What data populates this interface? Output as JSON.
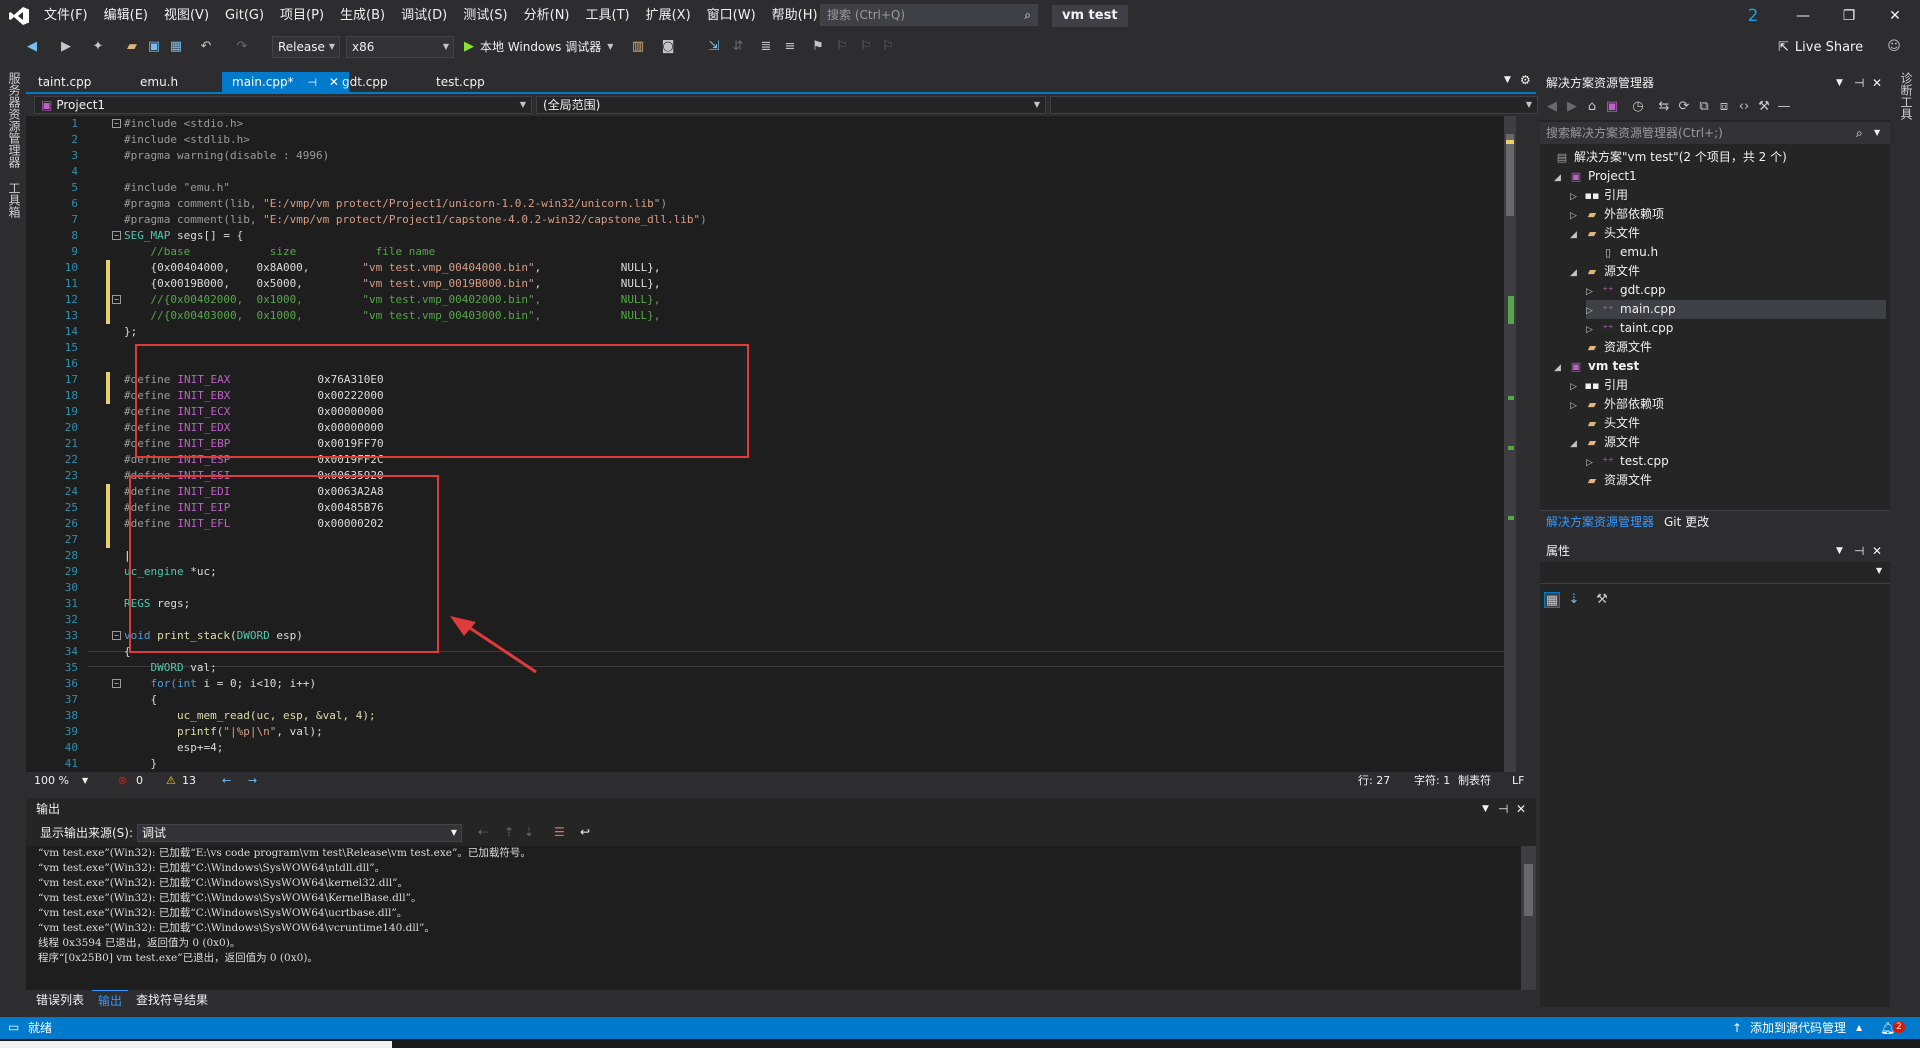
{
  "window": {
    "solution_name": "vm test",
    "notification_count": "2",
    "search_placeholder": "搜索 (Ctrl+Q)"
  },
  "menu": [
    "文件(F)",
    "编辑(E)",
    "视图(V)",
    "Git(G)",
    "项目(P)",
    "生成(B)",
    "调试(D)",
    "测试(S)",
    "分析(N)",
    "工具(T)",
    "扩展(X)",
    "窗口(W)",
    "帮助(H)"
  ],
  "toolbar": {
    "config": "Release",
    "platform": "x86",
    "run_label": "本地 Windows 调试器",
    "live_share": "Live Share"
  },
  "left_strip": [
    "服务器资源管理器",
    "工具箱"
  ],
  "right_strip": [
    "诊断工具"
  ],
  "tabs": [
    {
      "label": "taint.cpp"
    },
    {
      "label": "emu.h"
    },
    {
      "label": "main.cpp*"
    },
    {
      "label": "gdt.cpp"
    },
    {
      "label": "test.cpp"
    }
  ],
  "nav": {
    "project": "Project1",
    "scope": "(全局范围)"
  },
  "code": {
    "line_numbers": [
      "1",
      "2",
      "3",
      "4",
      "5",
      "6",
      "7",
      "8",
      "9",
      "10",
      "11",
      "12",
      "13",
      "14",
      "15",
      "16",
      "17",
      "18",
      "19",
      "20",
      "21",
      "22",
      "23",
      "24",
      "25",
      "26",
      "27",
      "28",
      "29",
      "30",
      "31",
      "32",
      "33",
      "34",
      "35",
      "36",
      "37",
      "38",
      "39",
      "40",
      "41"
    ],
    "l1": "#include <stdio.h>",
    "l2": "#include <stdlib.h>",
    "l3": "#pragma warning(disable : 4996)",
    "l5": "#include \"emu.h\"",
    "l6a": "#pragma comment(lib, ",
    "l6b": "\"E:/vmp/vm protect/Project1/unicorn-1.0.2-win32/unicorn.lib\"",
    "l6c": ")",
    "l7a": "#pragma comment(lib, ",
    "l7b": "\"E:/vmp/vm protect/Project1/capstone-4.0.2-win32/capstone_dll.lib\"",
    "l7c": ")",
    "l8a": "SEG_MAP",
    "l8b": " segs[] = {",
    "l9": "    //base            size            file name",
    "l10a": "    {0x00404000,    0x8A000,        ",
    "l10b": "\"vm test.vmp_00404000.bin\"",
    "l10c": ",            NULL},",
    "l11a": "    {0x0019B000,    0x5000,         ",
    "l11b": "\"vm test.vmp_0019B000.bin\"",
    "l11c": ",            NULL},",
    "l12": "    //{0x00402000,  0x1000,         \"vm test.vmp_00402000.bin\",            NULL},",
    "l13": "    //{0x00403000,  0x1000,         \"vm test.vmp_00403000.bin\",            NULL},",
    "l14": "};",
    "defines": [
      {
        "name": "INIT_EAX",
        "value": "0x76A310E0"
      },
      {
        "name": "INIT_EBX",
        "value": "0x00222000"
      },
      {
        "name": "INIT_ECX",
        "value": "0x00000000"
      },
      {
        "name": "INIT_EDX",
        "value": "0x00000000"
      },
      {
        "name": "INIT_EBP",
        "value": "0x0019FF70"
      },
      {
        "name": "INIT_ESP",
        "value": "0x0019FF2C"
      },
      {
        "name": "INIT_ESI",
        "value": "0x00635920"
      },
      {
        "name": "INIT_EDI",
        "value": "0x0063A2A8"
      },
      {
        "name": "INIT_EIP",
        "value": "0x00485B76"
      },
      {
        "name": "INIT_EFL",
        "value": "0x00000202"
      }
    ],
    "define_kw": "#define",
    "l28a": "uc_engine",
    "l28b": " *uc;",
    "l30a": "REGS",
    "l30b": " regs;",
    "l33a": "void",
    "l33b": " print_stack(",
    "l33c": "DWORD",
    "l33d": " esp)",
    "l34": "{",
    "l35a": "    DWORD",
    "l35b": " val;",
    "l36a": "    for(",
    "l36b": "int",
    "l36c": " i = 0; i<10; i++)",
    "l37": "    {",
    "l38": "        uc_mem_read(uc, esp, &val, 4);",
    "l39a": "        printf(",
    "l39b": "\"|%p|\\n\"",
    "l39c": ", val);",
    "l40": "        esp+=4;",
    "l41": "    }"
  },
  "editor_status": {
    "zoom": "100 %",
    "errors": "0",
    "warnings": "13",
    "line": "行: 27",
    "col": "字符: 1",
    "tabs": "制表符",
    "eol": "LF"
  },
  "output": {
    "title": "输出",
    "source_label": "显示输出来源(S):",
    "source_value": "调试",
    "lines": [
      "“vm test.exe”(Win32): 已加载“E:\\vs code program\\vm test\\Release\\vm test.exe”。已加载符号。",
      "“vm test.exe”(Win32): 已加载“C:\\Windows\\SysWOW64\\ntdll.dll”。",
      "“vm test.exe”(Win32): 已加载“C:\\Windows\\SysWOW64\\kernel32.dll”。",
      "“vm test.exe”(Win32): 已加载“C:\\Windows\\SysWOW64\\KernelBase.dll”。",
      "“vm test.exe”(Win32): 已加载“C:\\Windows\\SysWOW64\\ucrtbase.dll”。",
      "“vm test.exe”(Win32): 已加载“C:\\Windows\\SysWOW64\\vcruntime140.dll”。",
      "线程 0x3594 已退出，返回值为 0 (0x0)。",
      "程序“[0x25B0] vm test.exe”已退出，返回值为 0 (0x0)。"
    ]
  },
  "bottom_tabs": [
    "错误列表",
    "输出",
    "查找符号结果"
  ],
  "solution_explorer": {
    "title": "解决方案资源管理器",
    "search_placeholder": "搜索解决方案资源管理器(Ctrl+;)",
    "items": [
      {
        "label": "解决方案\"vm test\"(2 个项目，共 2 个)"
      },
      {
        "label": "Project1"
      },
      {
        "label": "引用"
      },
      {
        "label": "外部依赖项"
      },
      {
        "label": "头文件"
      },
      {
        "label": "emu.h"
      },
      {
        "label": "源文件"
      },
      {
        "label": "gdt.cpp"
      },
      {
        "label": "main.cpp"
      },
      {
        "label": "taint.cpp"
      },
      {
        "label": "资源文件"
      },
      {
        "label": "vm test"
      },
      {
        "label": "引用"
      },
      {
        "label": "外部依赖项"
      },
      {
        "label": "头文件"
      },
      {
        "label": "源文件"
      },
      {
        "label": "test.cpp"
      },
      {
        "label": "资源文件"
      }
    ],
    "tabs": [
      "解决方案资源管理器",
      "Git 更改"
    ]
  },
  "properties": {
    "title": "属性"
  },
  "statusbar": {
    "ready": "就绪",
    "source_control": "添加到源代码管理",
    "notif": "2"
  },
  "colors": {
    "accent": "#007acc",
    "highlight_box": "#e03a3a",
    "change_bar": "#e8d06a"
  }
}
